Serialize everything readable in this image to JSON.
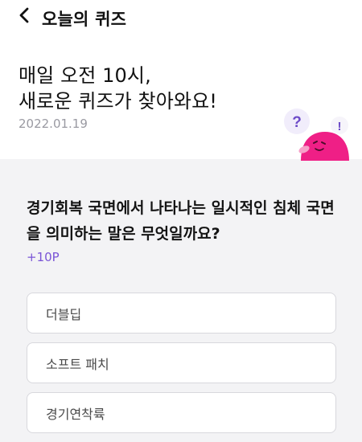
{
  "header": {
    "back_icon": "chevron-left-icon",
    "title": "오늘의 퀴즈"
  },
  "hero": {
    "line1": "매일 오전 10시,",
    "line2": "새로운 퀴즈가 찾아와요!",
    "date": "2022.01.19",
    "mascot_icon": "pink-mascot-icon",
    "question_mark": "?",
    "exclamation_mark": "!"
  },
  "quiz": {
    "question_line1": "경기회복 국면에서 나타나는 일시적인 침체 국면",
    "question_line2": "을 의미하는 말은 무엇일까요?",
    "points": "+10P",
    "options": [
      {
        "label": "더블딥"
      },
      {
        "label": "소프트 패치"
      },
      {
        "label": "경기연착륙"
      }
    ]
  },
  "colors": {
    "accent_purple": "#7a54d6",
    "mascot_pink": "#ef1f86",
    "background_gray": "#f3f3f5"
  }
}
